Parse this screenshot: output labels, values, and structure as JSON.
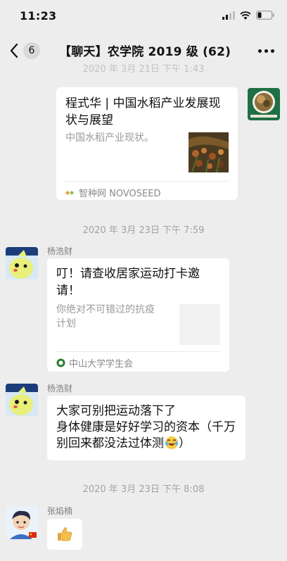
{
  "status_bar": {
    "time": "11:23"
  },
  "nav": {
    "unread_count": "6",
    "title": "【聊天】农学院 2019 级 (62)"
  },
  "messages": {
    "ts_top": "2020 年 3月 21日 下午 1:43",
    "card1": {
      "title": "程式华 | 中国水稻产业发展现状与展望",
      "desc": "中国水稻产业现状。",
      "source": "智种网 NOVOSEED"
    },
    "ts1": "2020 年 3月 23日  下午 7:59",
    "msg1": {
      "sender": "杨浩财",
      "title": "叮！请查收居家运动打卡邀请！",
      "desc": "你绝对不可错过的抗疫计划",
      "source": "中山大学学生会"
    },
    "msg2": {
      "sender": "杨浩财",
      "text": "大家可别把运动落下了\n身体健康是好好学习的资本（千万别回来都没法过体测"
    },
    "ts2": "2020 年 3月 23日  下午 8:08",
    "msg3": {
      "sender": "张焰楠"
    }
  }
}
